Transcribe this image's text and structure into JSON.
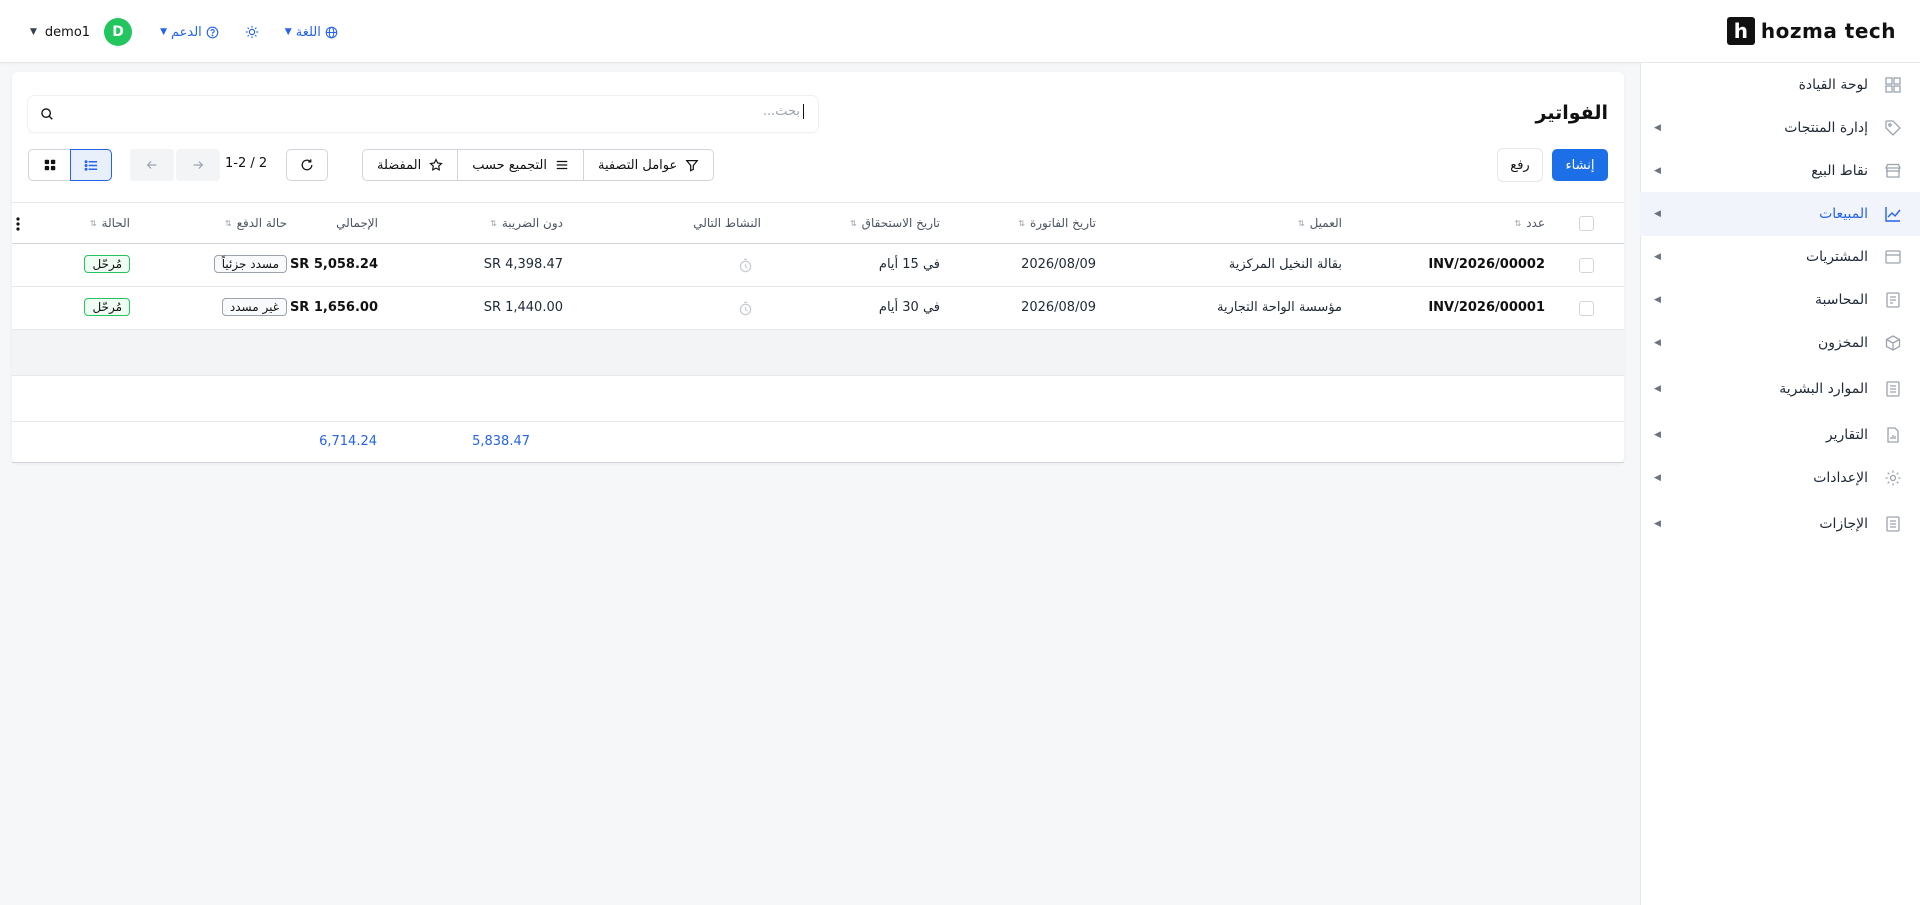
{
  "brand": {
    "logo_letter": "h",
    "name": "hozma tech"
  },
  "topbar": {
    "user": "demo1",
    "avatar_initial": "D",
    "support_label": "الدعم",
    "language_label": "اللغة"
  },
  "sidebar": {
    "items": [
      {
        "label": "لوحة القيادة",
        "icon": "dashboard-icon"
      },
      {
        "label": "إدارة المنتجات",
        "icon": "tag-icon"
      },
      {
        "label": "نقاط البيع",
        "icon": "store-icon"
      },
      {
        "label": "المبيعات",
        "icon": "chart-line-icon",
        "active": true
      },
      {
        "label": "المشتريات",
        "icon": "wallet-icon"
      },
      {
        "label": "المحاسبة",
        "icon": "ledger-icon"
      },
      {
        "label": "المخزون",
        "icon": "box-icon"
      },
      {
        "label": "الموارد البشرية",
        "icon": "document-icon"
      },
      {
        "label": "التقارير",
        "icon": "report-icon"
      },
      {
        "label": "الإعدادات",
        "icon": "gear-icon"
      },
      {
        "label": "الإجازات",
        "icon": "document-icon"
      }
    ]
  },
  "page": {
    "title": "الفواتير",
    "search_placeholder": "بحث...",
    "create_label": "إنشاء",
    "upload_label": "رفع",
    "filters_label": "عوامل التصفية",
    "group_by_label": "التجميع حسب",
    "favorites_label": "المفضلة",
    "pager": "1-2 / 2"
  },
  "table": {
    "headers": {
      "number": "عدد",
      "customer": "العميل",
      "invoice_date": "تاريخ الفاتورة",
      "due_date": "تاريخ الاستحقاق",
      "next_activity": "النشاط التالي",
      "untaxed": "دون الضريبة",
      "total": "الإجمالي",
      "payment_status": "حالة الدفع",
      "status": "الحالة"
    },
    "rows": [
      {
        "number": "INV/2026/00002",
        "customer": "بقالة النخيل المركزية",
        "invoice_date": "2026/08/09",
        "due_date": "في 15 أيام",
        "untaxed": "SR 4,398.47",
        "total": "SR 5,058.24",
        "payment_status": "مسدد جزئياً",
        "status": "مُرحّل"
      },
      {
        "number": "INV/2026/00001",
        "customer": "مؤسسة الواحة التجارية",
        "invoice_date": "2026/08/09",
        "due_date": "في 30 أيام",
        "untaxed": "SR 1,440.00",
        "total": "SR 1,656.00",
        "payment_status": "غير مسدد",
        "status": "مُرحّل"
      }
    ],
    "totals": {
      "untaxed": "5,838.47",
      "total": "6,714.24"
    }
  },
  "colors": {
    "accent": "#1d6fe8",
    "avatar": "#22c55e",
    "posted_badge_border": "#22c55e"
  }
}
